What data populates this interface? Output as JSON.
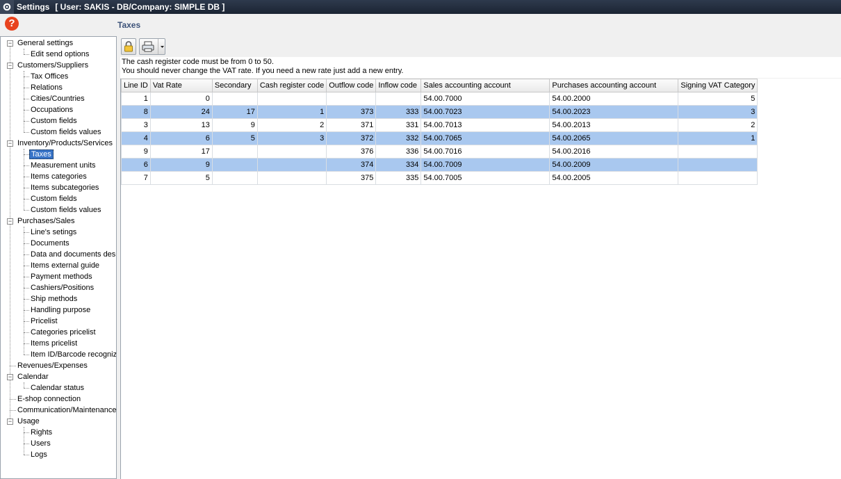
{
  "window": {
    "title": "Settings",
    "info": "[ User: SAKIS - DB/Company: SIMPLE DB ]"
  },
  "help": {
    "glyph": "?"
  },
  "section": {
    "title": "Taxes"
  },
  "info": {
    "line1": "The cash register code must be from 0 to 50.",
    "line2": "You should never change the VAT rate. If you need a new rate just add a new entry."
  },
  "tree": {
    "general": {
      "label": "General settings",
      "items": [
        "Edit send options"
      ]
    },
    "customers": {
      "label": "Customers/Suppliers",
      "items": [
        "Tax Offices",
        "Relations",
        "Cities/Countries",
        "Occupations",
        "Custom fields",
        "Custom fields values"
      ]
    },
    "inventory": {
      "label": "Inventory/Products/Services",
      "items": [
        "Taxes",
        "Measurement units",
        "Items categories",
        "Items subcategories",
        "Custom fields",
        "Custom fields values"
      ],
      "selected": "Taxes"
    },
    "purchases": {
      "label": "Purchases/Sales",
      "items": [
        "Line's setings",
        "Documents",
        "Data and documents desi",
        "Items external guide",
        "Payment methods",
        "Cashiers/Positions",
        "Ship methods",
        "Handling purpose",
        "Pricelist",
        "Categories pricelist",
        "Items pricelist",
        "Item ID/Barcode recognize"
      ]
    },
    "revenues": {
      "label": "Revenues/Expenses"
    },
    "calendar": {
      "label": "Calendar",
      "items": [
        "Calendar status"
      ]
    },
    "eshop": {
      "label": "E-shop connection"
    },
    "communication": {
      "label": "Communication/Maintenance"
    },
    "usage": {
      "label": "Usage",
      "items": [
        "Rights",
        "Users",
        "Logs"
      ]
    }
  },
  "grid": {
    "columns": [
      "Line ID",
      "Vat Rate",
      "Secondary",
      "Cash register code",
      "Outflow code",
      "Inflow code",
      "Sales accounting account",
      "Purchases accounting account",
      "Signing VAT Category"
    ],
    "rows": [
      [
        "1",
        "0",
        "",
        "",
        "",
        "",
        "54.00.7000",
        "54.00.2000",
        "5"
      ],
      [
        "8",
        "24",
        "17",
        "1",
        "373",
        "333",
        "54.00.7023",
        "54.00.2023",
        "3"
      ],
      [
        "3",
        "13",
        "9",
        "2",
        "371",
        "331",
        "54.00.7013",
        "54.00.2013",
        "2"
      ],
      [
        "4",
        "6",
        "5",
        "3",
        "372",
        "332",
        "54.00.7065",
        "54.00.2065",
        "1"
      ],
      [
        "9",
        "17",
        "",
        "",
        "376",
        "336",
        "54.00.7016",
        "54.00.2016",
        ""
      ],
      [
        "6",
        "9",
        "",
        "",
        "374",
        "334",
        "54.00.7009",
        "54.00.2009",
        ""
      ],
      [
        "7",
        "5",
        "",
        "",
        "375",
        "335",
        "54.00.7005",
        "54.00.2005",
        ""
      ]
    ]
  },
  "colors": {
    "selection": "#a9c8ef",
    "tree_selected": "#3874c8",
    "help": "#e8431e"
  }
}
